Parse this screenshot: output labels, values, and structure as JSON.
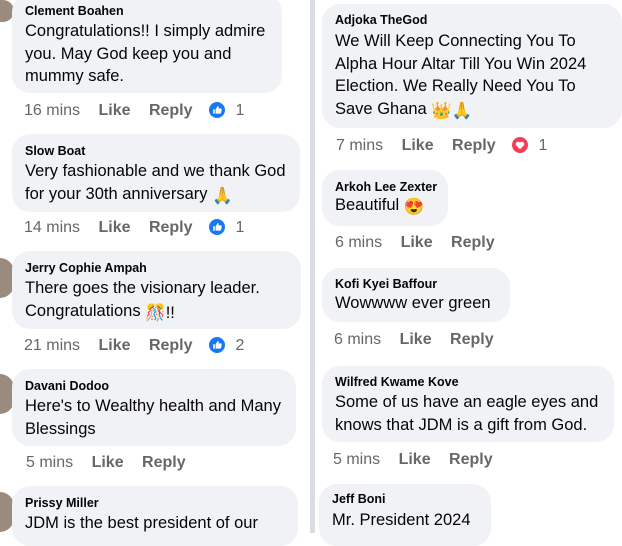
{
  "left_comments": [
    {
      "name": "Clement Boahen",
      "text": "Congratulations!! I simply admire\nyou. May God keep you and\nmummy safe.",
      "time": "16 mins",
      "like": "Like",
      "reply": "Reply",
      "reaction_count": "1",
      "reaction_icon": "like-reaction-icon"
    },
    {
      "name": "Slow Boat",
      "text": "Very fashionable and we thank God\nfor your 30th anniversary",
      "emoji": "🙏",
      "time": "14 mins",
      "like": "Like",
      "reply": "Reply",
      "reaction_count": "1",
      "reaction_icon": "like-reaction-icon"
    },
    {
      "name": "Jerry Cophie Ampah",
      "text": "There goes the visionary leader.\nCongratulations",
      "emoji": "🎊!!",
      "time": "21 mins",
      "like": "Like",
      "reply": "Reply",
      "reaction_count": "2",
      "reaction_icon": "like-reaction-icon"
    },
    {
      "name": "Davani Dodoo",
      "text": "Here's to Wealthy health and Many\nBlessings",
      "time": "5 mins",
      "like": "Like",
      "reply": "Reply"
    },
    {
      "name": "Prissy Miller",
      "text": "JDM is the best president of our"
    }
  ],
  "right_comments": [
    {
      "name": "Adjoka TheGod",
      "text": "We Will Keep Connecting You To\nAlpha Hour Altar Till You Win 2024\nElection. We Really Need You To\nSave Ghana",
      "emoji": "👑🙏",
      "time": "7 mins",
      "like": "Like",
      "reply": "Reply",
      "reaction_count": "1",
      "reaction_icon": "love-reaction-icon"
    },
    {
      "name": "Arkoh Lee Zexter",
      "text": "Beautiful",
      "emoji": "😍",
      "time": "6 mins",
      "like": "Like",
      "reply": "Reply"
    },
    {
      "name": "Kofi Kyei Baffour",
      "text": "Wowwww ever green",
      "time": "6 mins",
      "like": "Like",
      "reply": "Reply"
    },
    {
      "name": "Wilfred Kwame Kove",
      "text": "Some of us have an eagle eyes and\nknows that JDM is a gift from God.",
      "time": "5 mins",
      "like": "Like",
      "reply": "Reply"
    },
    {
      "name": "Jeff Boni",
      "text": "Mr. President 2024"
    }
  ],
  "colors": {
    "bubble": "#f0f2f5",
    "meta_text": "#65676b",
    "like_blue": "#1877f2",
    "love_red": "#f33e58",
    "divider": "#dadde1"
  }
}
